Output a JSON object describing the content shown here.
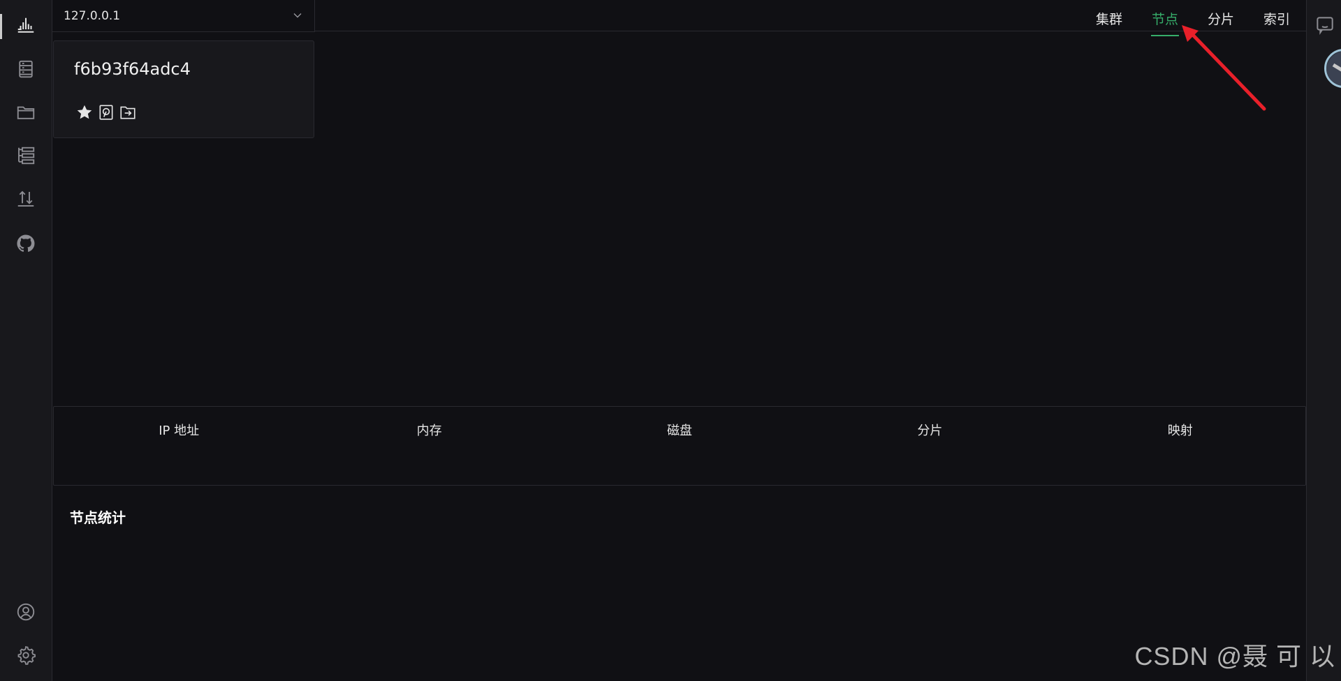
{
  "header": {
    "host": "127.0.0.1"
  },
  "tabs": [
    {
      "label": "集群",
      "active": false
    },
    {
      "label": "节点",
      "active": true
    },
    {
      "label": "分片",
      "active": false
    },
    {
      "label": "索引",
      "active": false
    }
  ],
  "node_card": {
    "name": "f6b93f64adc4",
    "icons": [
      "star-icon",
      "disk-icon",
      "folder-export-icon"
    ]
  },
  "table": {
    "columns": [
      "IP 地址",
      "内存",
      "磁盘",
      "分片",
      "映射"
    ]
  },
  "section": {
    "title": "节点统计"
  },
  "sidebar": {
    "icons": [
      "dashboard-icon",
      "server-icon",
      "folder-icon",
      "list-tree-icon",
      "import-export-icon",
      "github-icon",
      "user-icon",
      "gear-icon"
    ]
  },
  "watermark": "CSDN @聂 可 以",
  "colors": {
    "accent": "#36ad6a",
    "background": "#101014",
    "annotation": "#e8202a"
  }
}
